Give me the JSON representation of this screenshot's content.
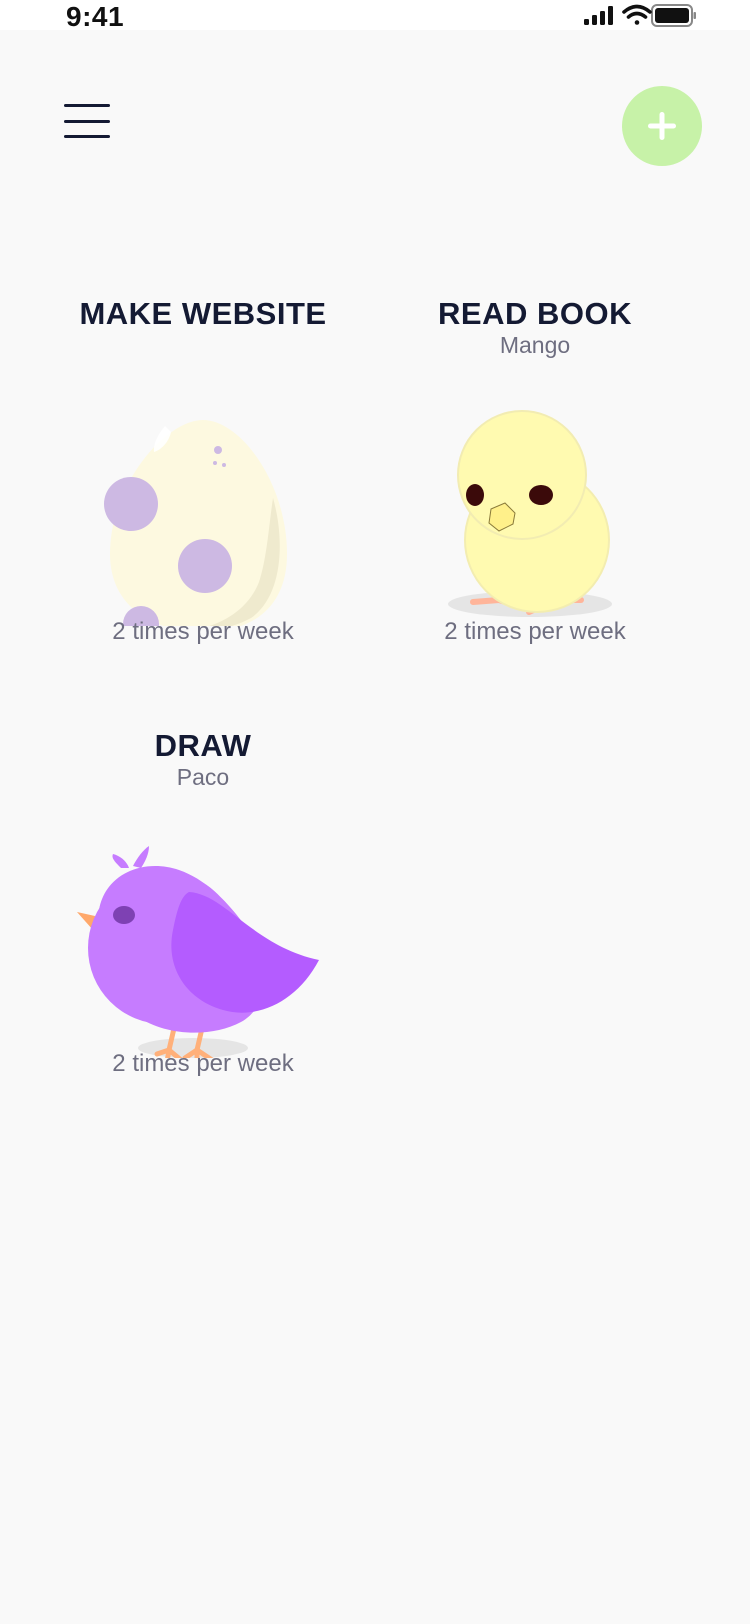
{
  "status_bar": {
    "time": "9:41",
    "icons": [
      "cellular-signal-icon",
      "wifi-icon",
      "battery-icon"
    ]
  },
  "header": {
    "menu_icon": "hamburger-menu-icon",
    "add_icon": "plus-icon"
  },
  "colors": {
    "background": "#f9f9f9",
    "add_button": "#c7f2a8",
    "title_text": "#141a33",
    "secondary_text": "#6e6e80",
    "egg_shell": "#fdf9e0",
    "egg_spots": "#cdb9e3",
    "chick_body": "#fffab0",
    "bird_body": "#c67cff",
    "bird_wing": "#b45cff"
  },
  "habits": [
    {
      "title": "MAKE WEBSITE",
      "pet_name": "",
      "pet_stage": "egg",
      "frequency": "2 times per week"
    },
    {
      "title": "READ BOOK",
      "pet_name": "Mango",
      "pet_stage": "chick",
      "frequency": "2 times per week"
    },
    {
      "title": "DRAW",
      "pet_name": "Paco",
      "pet_stage": "bird",
      "frequency": "2 times per week"
    }
  ]
}
